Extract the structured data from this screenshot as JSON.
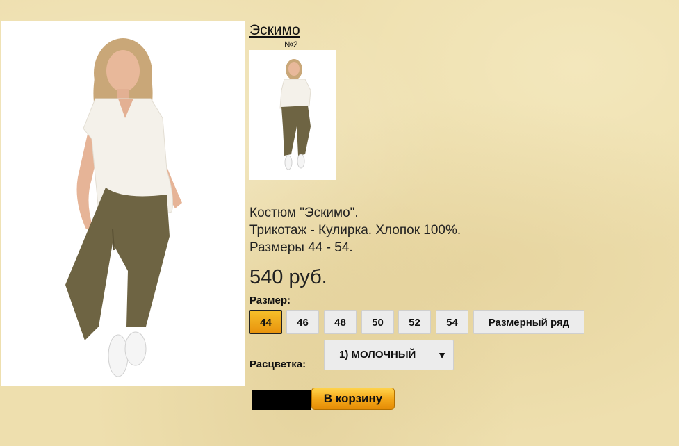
{
  "product": {
    "title": "Эскимо",
    "thumbnail_number": "№2",
    "description": [
      "Костюм \"Эскимо\".",
      "Трикотаж - Кулирка. Хлопок 100%.",
      "Размеры 44 - 54."
    ],
    "price": "540 руб."
  },
  "size": {
    "label": "Размер:",
    "options": [
      "44",
      "46",
      "48",
      "50",
      "52",
      "54"
    ],
    "selected": "44",
    "size_chart_label": "Размерный ряд"
  },
  "color": {
    "label": "Расцветка:",
    "selected": "1) МОЛОЧНЫЙ",
    "arrow": "▼"
  },
  "cart": {
    "quantity": "",
    "add_label": "В корзину"
  },
  "colors": {
    "accent": "#f4a81a",
    "pants": "#6e6443",
    "top": "#f4f1ea"
  }
}
